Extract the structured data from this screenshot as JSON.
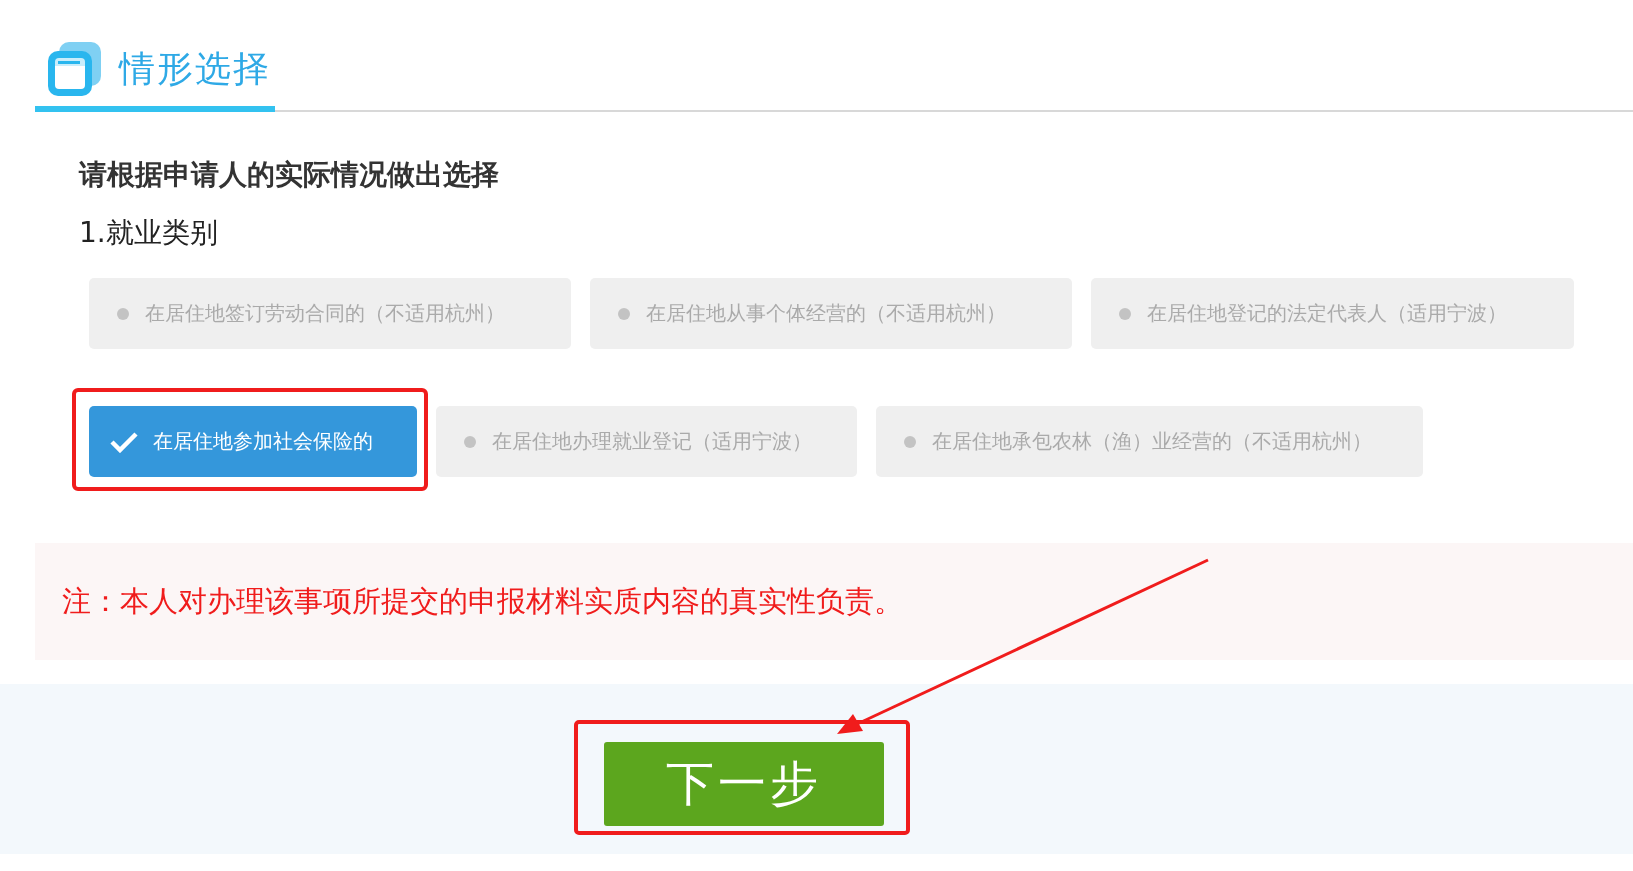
{
  "section": {
    "title": "情形选择"
  },
  "prompt": "请根据申请人的实际情况做出选择",
  "question": {
    "label": "1.就业类别",
    "options": [
      {
        "label": "在居住地签订劳动合同的（不适用杭州）",
        "selected": false,
        "highlighted": false
      },
      {
        "label": "在居住地从事个体经营的（不适用杭州）",
        "selected": false,
        "highlighted": false
      },
      {
        "label": "在居住地登记的法定代表人（适用宁波）",
        "selected": false,
        "highlighted": false
      },
      {
        "label": "在居住地参加社会保险的",
        "selected": true,
        "highlighted": true
      },
      {
        "label": "在居住地办理就业登记（适用宁波）",
        "selected": false,
        "highlighted": false
      },
      {
        "label": "在居住地承包农林（渔）业经营的（不适用杭州）",
        "selected": false,
        "highlighted": false
      }
    ]
  },
  "note": "注：本人对办理该事项所提交的申报材料实质内容的真实性负责。",
  "next_button": {
    "label": "下一步",
    "highlighted": true,
    "arrow_pointer": true
  }
}
